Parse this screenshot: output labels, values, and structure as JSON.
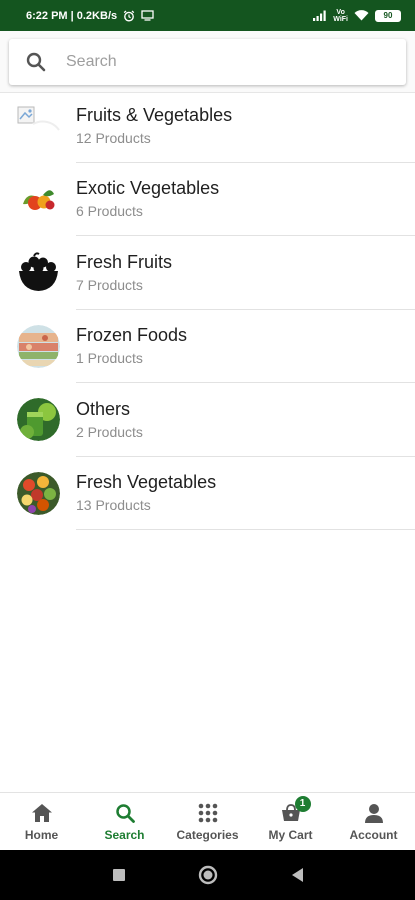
{
  "status_bar": {
    "time_info": "6:22 PM | 0.2KB/s",
    "network_label_top": "Vo",
    "network_label_bottom": "WiFi",
    "battery": "90"
  },
  "search": {
    "placeholder": "Search"
  },
  "categories": [
    {
      "name": "Fruits & Vegetables",
      "count": "12 Products",
      "icon": "broken-image-icon"
    },
    {
      "name": "Exotic Vegetables",
      "count": "6 Products",
      "icon": "vegetables-photo"
    },
    {
      "name": "Fresh Fruits",
      "count": "7 Products",
      "icon": "fruit-bowl-icon"
    },
    {
      "name": "Frozen Foods",
      "count": "1 Products",
      "icon": "frozen-food-photo"
    },
    {
      "name": "Others",
      "count": "2 Products",
      "icon": "green-juice-photo"
    },
    {
      "name": "Fresh Vegetables",
      "count": "13 Products",
      "icon": "vegetables-basket-photo"
    }
  ],
  "bottom_nav": {
    "items": [
      {
        "label": "Home",
        "icon": "home-icon"
      },
      {
        "label": "Search",
        "icon": "search-icon",
        "active": true
      },
      {
        "label": "Categories",
        "icon": "grid-icon"
      },
      {
        "label": "My Cart",
        "icon": "cart-icon",
        "badge": "1"
      },
      {
        "label": "Account",
        "icon": "account-icon"
      }
    ]
  },
  "colors": {
    "brand_dark": "#14551f",
    "accent": "#1e7d32"
  }
}
